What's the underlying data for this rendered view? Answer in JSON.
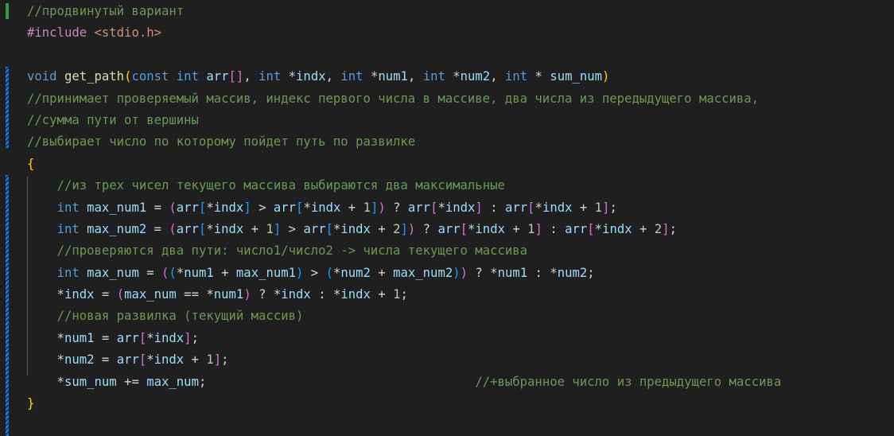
{
  "editor": {
    "language": "c",
    "colors": {
      "background": "#1f1f1f",
      "comment": "#6a9955",
      "keyword": "#569cd6",
      "preprocessor": "#c586c0",
      "string": "#ce9178",
      "function": "#dcdcaa",
      "variable": "#9cdcfe",
      "number": "#b5cea8",
      "bracket1": "#ffd700",
      "bracket2": "#da70d6",
      "bracket3": "#179fff",
      "git_added": "#2ea043",
      "git_modified": "#1b81e5"
    },
    "lines": [
      [
        {
          "t": "//продвинутый вариант",
          "c": "cm"
        }
      ],
      [
        {
          "t": "#include",
          "c": "pp"
        },
        {
          "t": " ",
          "c": "op"
        },
        {
          "t": "<stdio.h>",
          "c": "str"
        }
      ],
      [],
      [
        {
          "t": "void",
          "c": "kw"
        },
        {
          "t": " ",
          "c": "op"
        },
        {
          "t": "get_path",
          "c": "fn"
        },
        {
          "t": "(",
          "c": "b1"
        },
        {
          "t": "const",
          "c": "kw"
        },
        {
          "t": " ",
          "c": "op"
        },
        {
          "t": "int",
          "c": "kw"
        },
        {
          "t": " ",
          "c": "op"
        },
        {
          "t": "arr",
          "c": "var"
        },
        {
          "t": "[",
          "c": "b2"
        },
        {
          "t": "]",
          "c": "b2"
        },
        {
          "t": ", ",
          "c": "op"
        },
        {
          "t": "int",
          "c": "kw"
        },
        {
          "t": " *",
          "c": "op"
        },
        {
          "t": "indx",
          "c": "var"
        },
        {
          "t": ", ",
          "c": "op"
        },
        {
          "t": "int",
          "c": "kw"
        },
        {
          "t": " *",
          "c": "op"
        },
        {
          "t": "num1",
          "c": "var"
        },
        {
          "t": ", ",
          "c": "op"
        },
        {
          "t": "int",
          "c": "kw"
        },
        {
          "t": " *",
          "c": "op"
        },
        {
          "t": "num2",
          "c": "var"
        },
        {
          "t": ", ",
          "c": "op"
        },
        {
          "t": "int",
          "c": "kw"
        },
        {
          "t": " * ",
          "c": "op"
        },
        {
          "t": "sum_num",
          "c": "var"
        },
        {
          "t": ")",
          "c": "b1"
        }
      ],
      [
        {
          "t": "//принимает проверяемый массив, индекс первого числа в массиве, два числа из передыдущего массива,",
          "c": "cm"
        }
      ],
      [
        {
          "t": "//сумма пути от вершины",
          "c": "cm"
        }
      ],
      [
        {
          "t": "//выбирает число по которому пойдет путь по развилке",
          "c": "cm"
        }
      ],
      [
        {
          "t": "{",
          "c": "b1"
        }
      ],
      [
        {
          "t": "    ",
          "c": "op"
        },
        {
          "t": "//из трех чисел текущего массива выбираются два максимальные",
          "c": "cm"
        }
      ],
      [
        {
          "t": "    ",
          "c": "op"
        },
        {
          "t": "int",
          "c": "kw"
        },
        {
          "t": " ",
          "c": "op"
        },
        {
          "t": "max_num1",
          "c": "var"
        },
        {
          "t": " = ",
          "c": "op"
        },
        {
          "t": "(",
          "c": "b2"
        },
        {
          "t": "arr",
          "c": "var"
        },
        {
          "t": "[",
          "c": "b3"
        },
        {
          "t": "*",
          "c": "op"
        },
        {
          "t": "indx",
          "c": "var"
        },
        {
          "t": "]",
          "c": "b3"
        },
        {
          "t": " > ",
          "c": "op"
        },
        {
          "t": "arr",
          "c": "var"
        },
        {
          "t": "[",
          "c": "b3"
        },
        {
          "t": "*",
          "c": "op"
        },
        {
          "t": "indx",
          "c": "var"
        },
        {
          "t": " + ",
          "c": "op"
        },
        {
          "t": "1",
          "c": "num"
        },
        {
          "t": "]",
          "c": "b3"
        },
        {
          "t": ")",
          "c": "b2"
        },
        {
          "t": " ? ",
          "c": "op"
        },
        {
          "t": "arr",
          "c": "var"
        },
        {
          "t": "[",
          "c": "b2"
        },
        {
          "t": "*",
          "c": "op"
        },
        {
          "t": "indx",
          "c": "var"
        },
        {
          "t": "]",
          "c": "b2"
        },
        {
          "t": " : ",
          "c": "op"
        },
        {
          "t": "arr",
          "c": "var"
        },
        {
          "t": "[",
          "c": "b2"
        },
        {
          "t": "*",
          "c": "op"
        },
        {
          "t": "indx",
          "c": "var"
        },
        {
          "t": " + ",
          "c": "op"
        },
        {
          "t": "1",
          "c": "num"
        },
        {
          "t": "]",
          "c": "b2"
        },
        {
          "t": ";",
          "c": "op"
        }
      ],
      [
        {
          "t": "    ",
          "c": "op"
        },
        {
          "t": "int",
          "c": "kw"
        },
        {
          "t": " ",
          "c": "op"
        },
        {
          "t": "max_num2",
          "c": "var"
        },
        {
          "t": " = ",
          "c": "op"
        },
        {
          "t": "(",
          "c": "b2"
        },
        {
          "t": "arr",
          "c": "var"
        },
        {
          "t": "[",
          "c": "b3"
        },
        {
          "t": "*",
          "c": "op"
        },
        {
          "t": "indx",
          "c": "var"
        },
        {
          "t": " + ",
          "c": "op"
        },
        {
          "t": "1",
          "c": "num"
        },
        {
          "t": "]",
          "c": "b3"
        },
        {
          "t": " > ",
          "c": "op"
        },
        {
          "t": "arr",
          "c": "var"
        },
        {
          "t": "[",
          "c": "b3"
        },
        {
          "t": "*",
          "c": "op"
        },
        {
          "t": "indx",
          "c": "var"
        },
        {
          "t": " + ",
          "c": "op"
        },
        {
          "t": "2",
          "c": "num"
        },
        {
          "t": "]",
          "c": "b3"
        },
        {
          "t": ")",
          "c": "b2"
        },
        {
          "t": " ? ",
          "c": "op"
        },
        {
          "t": "arr",
          "c": "var"
        },
        {
          "t": "[",
          "c": "b2"
        },
        {
          "t": "*",
          "c": "op"
        },
        {
          "t": "indx",
          "c": "var"
        },
        {
          "t": " + ",
          "c": "op"
        },
        {
          "t": "1",
          "c": "num"
        },
        {
          "t": "]",
          "c": "b2"
        },
        {
          "t": " : ",
          "c": "op"
        },
        {
          "t": "arr",
          "c": "var"
        },
        {
          "t": "[",
          "c": "b2"
        },
        {
          "t": "*",
          "c": "op"
        },
        {
          "t": "indx",
          "c": "var"
        },
        {
          "t": " + ",
          "c": "op"
        },
        {
          "t": "2",
          "c": "num"
        },
        {
          "t": "]",
          "c": "b2"
        },
        {
          "t": ";",
          "c": "op"
        }
      ],
      [
        {
          "t": "    ",
          "c": "op"
        },
        {
          "t": "//проверяются два пути: число1/число2 -> числа текущего массива",
          "c": "cm"
        }
      ],
      [
        {
          "t": "    ",
          "c": "op"
        },
        {
          "t": "int",
          "c": "kw"
        },
        {
          "t": " ",
          "c": "op"
        },
        {
          "t": "max_num",
          "c": "var"
        },
        {
          "t": " = ",
          "c": "op"
        },
        {
          "t": "(",
          "c": "b2"
        },
        {
          "t": "(",
          "c": "b3"
        },
        {
          "t": "*",
          "c": "op"
        },
        {
          "t": "num1",
          "c": "var"
        },
        {
          "t": " + ",
          "c": "op"
        },
        {
          "t": "max_num1",
          "c": "var"
        },
        {
          "t": ")",
          "c": "b3"
        },
        {
          "t": " > ",
          "c": "op"
        },
        {
          "t": "(",
          "c": "b3"
        },
        {
          "t": "*",
          "c": "op"
        },
        {
          "t": "num2",
          "c": "var"
        },
        {
          "t": " + ",
          "c": "op"
        },
        {
          "t": "max_num2",
          "c": "var"
        },
        {
          "t": ")",
          "c": "b3"
        },
        {
          "t": ")",
          "c": "b2"
        },
        {
          "t": " ? *",
          "c": "op"
        },
        {
          "t": "num1",
          "c": "var"
        },
        {
          "t": " : *",
          "c": "op"
        },
        {
          "t": "num2",
          "c": "var"
        },
        {
          "t": ";",
          "c": "op"
        }
      ],
      [
        {
          "t": "    *",
          "c": "op"
        },
        {
          "t": "indx",
          "c": "var"
        },
        {
          "t": " = ",
          "c": "op"
        },
        {
          "t": "(",
          "c": "b2"
        },
        {
          "t": "max_num",
          "c": "var"
        },
        {
          "t": " == *",
          "c": "op"
        },
        {
          "t": "num1",
          "c": "var"
        },
        {
          "t": ")",
          "c": "b2"
        },
        {
          "t": " ? *",
          "c": "op"
        },
        {
          "t": "indx",
          "c": "var"
        },
        {
          "t": " : *",
          "c": "op"
        },
        {
          "t": "indx",
          "c": "var"
        },
        {
          "t": " + ",
          "c": "op"
        },
        {
          "t": "1",
          "c": "num"
        },
        {
          "t": ";",
          "c": "op"
        }
      ],
      [
        {
          "t": "    ",
          "c": "op"
        },
        {
          "t": "//новая развилка (текущий массив)",
          "c": "cm"
        }
      ],
      [
        {
          "t": "    *",
          "c": "op"
        },
        {
          "t": "num1",
          "c": "var"
        },
        {
          "t": " = ",
          "c": "op"
        },
        {
          "t": "arr",
          "c": "var"
        },
        {
          "t": "[",
          "c": "b2"
        },
        {
          "t": "*",
          "c": "op"
        },
        {
          "t": "indx",
          "c": "var"
        },
        {
          "t": "]",
          "c": "b2"
        },
        {
          "t": ";",
          "c": "op"
        }
      ],
      [
        {
          "t": "    *",
          "c": "op"
        },
        {
          "t": "num2",
          "c": "var"
        },
        {
          "t": " = ",
          "c": "op"
        },
        {
          "t": "arr",
          "c": "var"
        },
        {
          "t": "[",
          "c": "b2"
        },
        {
          "t": "*",
          "c": "op"
        },
        {
          "t": "indx",
          "c": "var"
        },
        {
          "t": " + ",
          "c": "op"
        },
        {
          "t": "1",
          "c": "num"
        },
        {
          "t": "]",
          "c": "b2"
        },
        {
          "t": ";",
          "c": "op"
        }
      ],
      [
        {
          "t": "    *",
          "c": "op"
        },
        {
          "t": "sum_num",
          "c": "var"
        },
        {
          "t": " += ",
          "c": "op"
        },
        {
          "t": "max_num",
          "c": "var"
        },
        {
          "t": ";                                    ",
          "c": "op"
        },
        {
          "t": "//+выбранное число из предыдущего массива",
          "c": "cm"
        }
      ],
      [
        {
          "t": "}",
          "c": "b1"
        }
      ]
    ]
  }
}
